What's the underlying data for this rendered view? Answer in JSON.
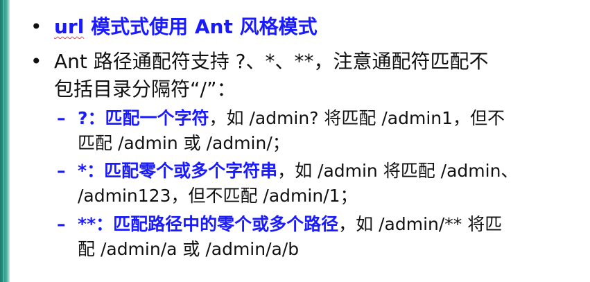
{
  "bullets": [
    {
      "parts": [
        "url",
        " 模式式使用 Ant 风格模式"
      ]
    },
    {
      "line1": "Ant 路径通配符支持 ?、*、**，注意通配符匹配不",
      "line2": "包括目录分隔符“/”："
    }
  ],
  "sub_items": [
    {
      "bold": "?：匹配一个字符",
      "line1": "，如 /admin? 将匹配 /admin1，但不",
      "line2": "匹配 /admin 或  /admin/；"
    },
    {
      "bold": "*：匹配零个或多个字符串",
      "line1": "，如 /admin 将匹配 /admin、",
      "line2": "/admin123，但不匹配 /admin/1；"
    },
    {
      "bold": "**：匹配路径中的零个或多个路径",
      "line1": "，如 /admin/** 将匹",
      "line2": "配 /admin/a 或 /admin/a/b"
    }
  ],
  "markers": {
    "bullet": "•",
    "dash": "–"
  },
  "colors": {
    "accent": "#1a1aff",
    "sidebar": "#2a9a88"
  }
}
